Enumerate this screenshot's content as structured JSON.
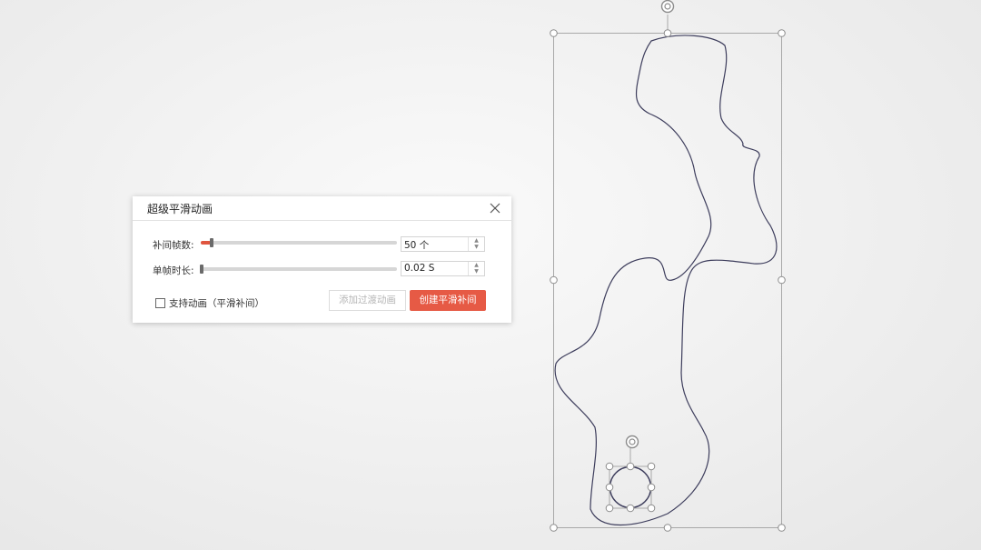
{
  "dialog": {
    "title": "超级平滑动画",
    "close_icon": "close-icon",
    "frames": {
      "label": "补间帧数:",
      "value": "50 个",
      "slider_level": 0.05
    },
    "duration": {
      "label": "单帧时长:",
      "value": "0.02 S",
      "slider_level": 0.0
    },
    "checkbox": {
      "label": "支持动画（平滑补间）",
      "checked": false
    },
    "buttons": {
      "add_transition": "添加过渡动画",
      "create_smooth": "创建平滑补间"
    }
  },
  "colors": {
    "accent": "#e65a45",
    "path_stroke": "#3d3d5c",
    "selection_frame": "#a8a8a8"
  },
  "canvas": {
    "icons": [
      "rotate-handle-icon",
      "resize-handle-icon"
    ]
  }
}
